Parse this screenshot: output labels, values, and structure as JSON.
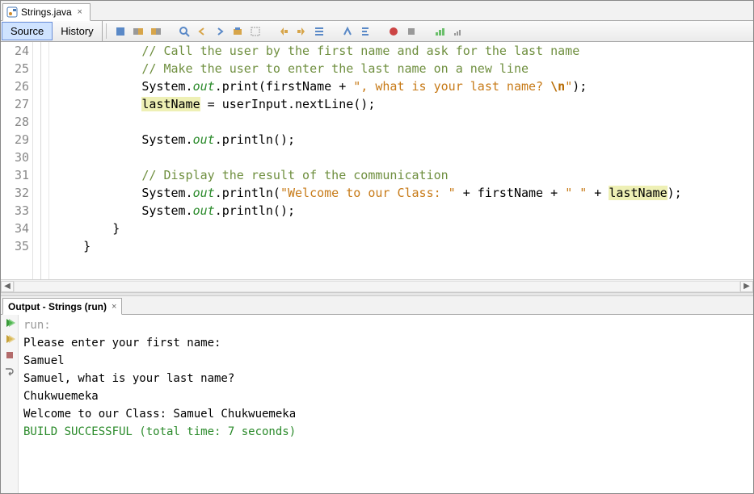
{
  "file_tab": {
    "name": "Strings.java",
    "close_glyph": "×"
  },
  "views": {
    "source": "Source",
    "history": "History"
  },
  "toolbar_icons": [
    "refactor-icon",
    "diff-icon",
    "diff-prev-icon",
    "search-icon",
    "nav-back-icon",
    "nav-fwd-icon",
    "select-in-icon",
    "toggle-highlight-icon",
    "shift-left-icon",
    "shift-right-icon",
    "comment-icon",
    "format-icon",
    "reformat-icon",
    "record-macro-icon",
    "stop-macro-icon",
    "chart-icon",
    "chart-small-icon"
  ],
  "gutter_start": 24,
  "gutter_end": 35,
  "code_lines": [
    {
      "indent": 12,
      "kind": "comment",
      "text": "// Call the user by the first name and ask for the last name"
    },
    {
      "indent": 12,
      "kind": "comment",
      "text": "// Make the user to enter the last name on a new line"
    },
    {
      "indent": 12,
      "kind": "print",
      "pre": "System.",
      "field": "out",
      "mid": ".print(firstName + ",
      "str_open": "\", what is your last name? ",
      "esc": "\\n",
      "str_close": "\"",
      "post": ");"
    },
    {
      "indent": 12,
      "kind": "assign",
      "hi": "lastName",
      "rest": " = userInput.nextLine();"
    },
    {
      "indent": 0,
      "kind": "blank"
    },
    {
      "indent": 12,
      "kind": "println0",
      "pre": "System.",
      "field": "out",
      "post": ".println();"
    },
    {
      "indent": 0,
      "kind": "blank"
    },
    {
      "indent": 12,
      "kind": "comment",
      "text": "// Display the result of the communication"
    },
    {
      "indent": 12,
      "kind": "println1",
      "pre": "System.",
      "field": "out",
      "mid": ".println(",
      "s1": "\"Welcome to our Class: \"",
      "mid2": " + firstName + ",
      "s2": "\" \"",
      "mid3": " + ",
      "hi": "lastName",
      "post": ");"
    },
    {
      "indent": 12,
      "kind": "println0",
      "pre": "System.",
      "field": "out",
      "post": ".println();"
    },
    {
      "indent": 8,
      "kind": "plain",
      "text": "}"
    },
    {
      "indent": 4,
      "kind": "plain",
      "text": "}"
    }
  ],
  "output": {
    "tab": "Output - Strings (run)",
    "close_glyph": "×",
    "sidebar_icons": [
      "run-again-icon",
      "run-again-2-icon",
      "stop-icon",
      "wrap-icon"
    ],
    "lines": [
      {
        "cls": "con-dim",
        "text": "run:"
      },
      {
        "cls": "",
        "text": "Please enter your first name: "
      },
      {
        "cls": "",
        "text": "Samuel"
      },
      {
        "cls": "",
        "text": ""
      },
      {
        "cls": "",
        "text": "Samuel, what is your last name? "
      },
      {
        "cls": "",
        "text": "Chukwuemeka"
      },
      {
        "cls": "",
        "text": ""
      },
      {
        "cls": "",
        "text": "Welcome to our Class: Samuel Chukwuemeka"
      },
      {
        "cls": "",
        "text": ""
      },
      {
        "cls": "con-ok",
        "text": "BUILD SUCCESSFUL (total time: 7 seconds)"
      }
    ]
  }
}
